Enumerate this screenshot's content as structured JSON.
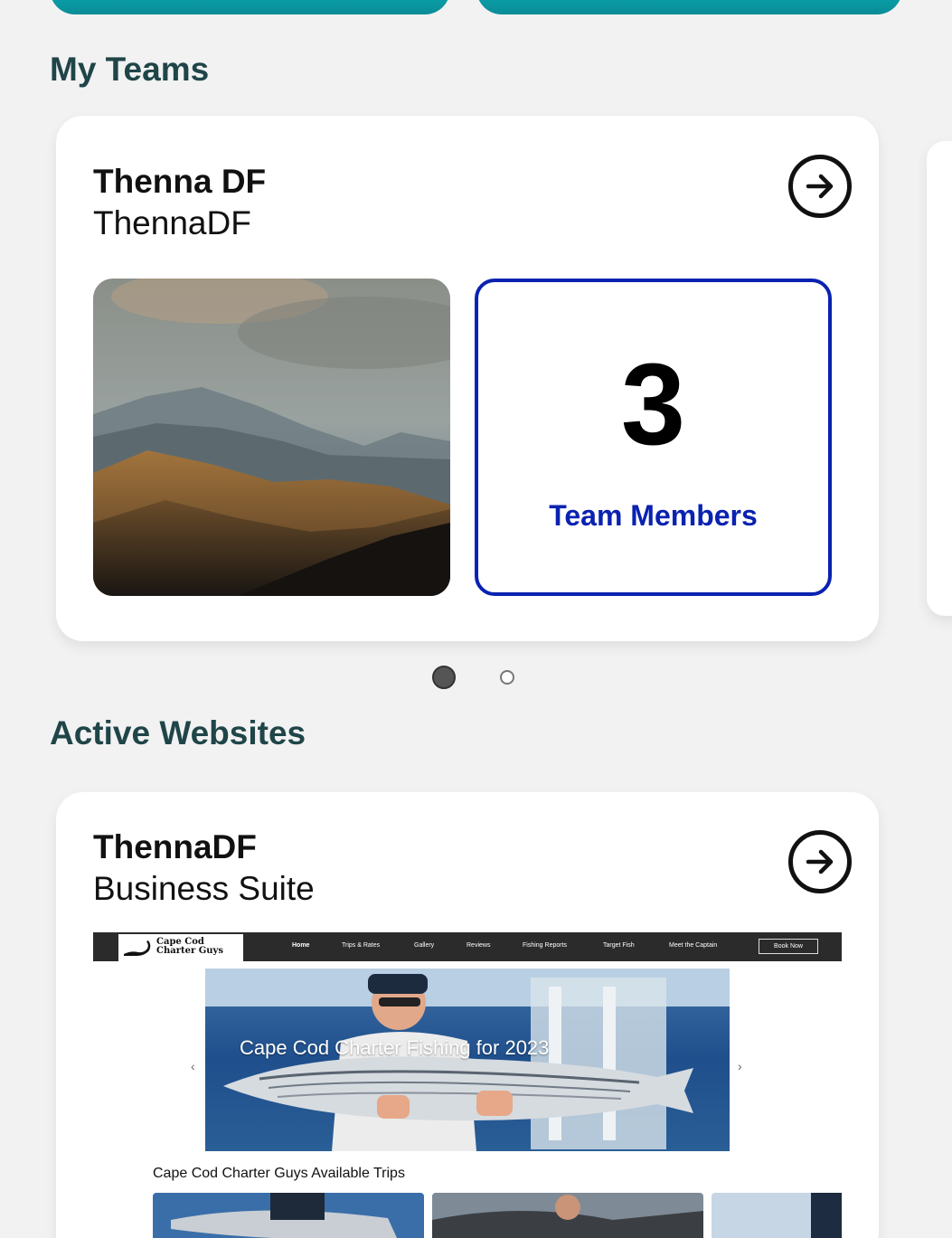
{
  "sections": {
    "teams_title": "My Teams",
    "sites_title": "Active Websites"
  },
  "team_card": {
    "name": "Thenna DF",
    "handle": "ThennaDF",
    "member_count": "3",
    "member_label": "Team Members",
    "carousel_pages": 2,
    "carousel_active": 1
  },
  "website_card": {
    "name": "ThennaDF",
    "subtitle": "Business Suite",
    "preview": {
      "logo_text": "Cape Cod Charter Guys",
      "nav": [
        "Home",
        "Trips & Rates",
        "Gallery",
        "Reviews",
        "Fishing Reports",
        "Target Fish",
        "Meet the Captain"
      ],
      "book_button": "Book Now",
      "hero_title": "Cape Cod Charter Fishing for 2023",
      "prev_arrow": "‹",
      "next_arrow": "›",
      "trips_title": "Cape Cod Charter Guys Available Trips"
    }
  },
  "icons": {
    "arrow": "arrow-right-circle-icon"
  },
  "colors": {
    "teal": "#0a9aa3",
    "section_title": "#1f4548",
    "accent_blue": "#0a22b0"
  }
}
